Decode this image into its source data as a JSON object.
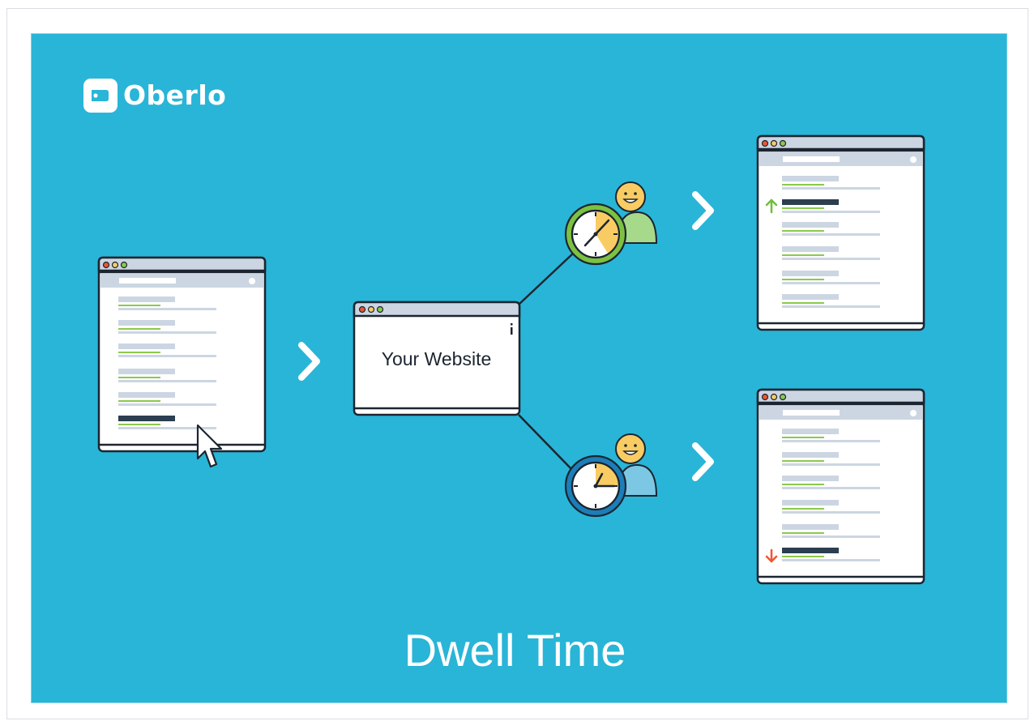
{
  "brand": {
    "name": "Oberlo"
  },
  "diagram": {
    "center_label": "Your Website",
    "caption": "Dwell Time",
    "colors": {
      "background": "#29b5d7",
      "window_bar": "#ccd6e2",
      "outline": "#1c2530",
      "highlight_row": "#2c3e50",
      "green_line": "#8cc94c",
      "up_arrow": "#6fbe3e",
      "down_arrow": "#f0552e",
      "clock_long_ring": "#7cc142",
      "clock_short_ring": "#1c7eb8",
      "clock_face_fill": "#f8cc63",
      "person_long": "#a6d98a",
      "person_short": "#7cc8e4",
      "face": "#f8cc63"
    },
    "icons": {
      "logo": "price-tag-icon",
      "cursor": "mouse-pointer-icon",
      "next": "chevron-right-icon",
      "up": "arrow-up-icon",
      "down": "arrow-down-icon",
      "clock": "clock-icon",
      "user": "smiling-user-icon"
    },
    "long_visit_clock_fill_pct": 37,
    "short_visit_clock_fill_pct": 25
  }
}
